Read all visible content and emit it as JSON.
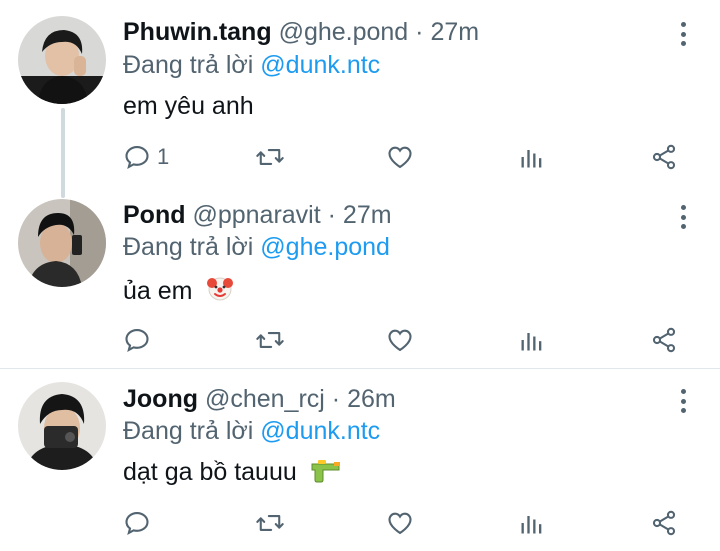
{
  "tweets": [
    {
      "name": "Phuwin.tang",
      "handle": "@ghe.pond",
      "sep": "·",
      "time": "27m",
      "reply_prefix": "Đang trả lời",
      "reply_to": "@dunk.ntc",
      "text": "em yêu anh",
      "reply_count": "1",
      "emoji": ""
    },
    {
      "name": "Pond",
      "handle": "@ppnaravit",
      "sep": "·",
      "time": "27m",
      "reply_prefix": "Đang trả lời",
      "reply_to": "@ghe.pond",
      "text": "ủa em",
      "reply_count": "",
      "emoji": "clown-face"
    },
    {
      "name": "Joong",
      "handle": "@chen_rcj",
      "sep": "·",
      "time": "26m",
      "reply_prefix": "Đang trả lời",
      "reply_to": "@dunk.ntc",
      "text": "dạt ga bồ tauuu",
      "reply_count": "",
      "emoji": "water-pistol"
    }
  ],
  "icons": {
    "reply": "reply-icon",
    "retweet": "retweet-icon",
    "like": "heart-icon",
    "analytics": "analytics-icon",
    "share": "share-icon",
    "more": "more-vertical-icon"
  },
  "colors": {
    "accent": "#1d9bf0",
    "muted": "#536471",
    "text": "#0f1419",
    "thread_line": "#cfd9de",
    "divider": "#e1e8ed"
  }
}
